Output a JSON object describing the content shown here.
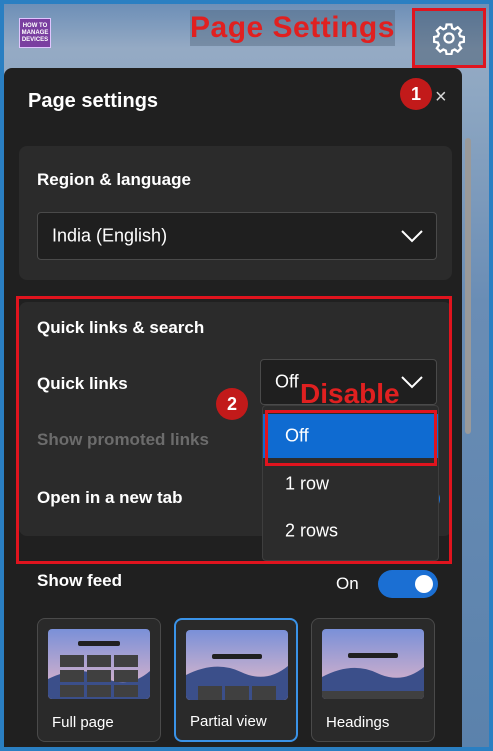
{
  "annotations": {
    "title": "Page Settings",
    "step1": "1",
    "step2": "2",
    "disable": "Disable"
  },
  "logo_text": "HOW TO MANAGE DEVICES",
  "panel": {
    "title": "Page settings",
    "close": "×"
  },
  "region": {
    "label": "Region & language",
    "value": "India (English)"
  },
  "quick": {
    "section_label": "Quick links & search",
    "quick_links_label": "Quick links",
    "quick_links_value": "Off",
    "show_promoted": "Show promoted links",
    "open_new_tab": "Open in a new tab",
    "options": [
      "Off",
      "1 row",
      "2 rows"
    ]
  },
  "feed": {
    "label": "Show feed",
    "state": "On",
    "layouts": [
      "Full page",
      "Partial view",
      "Headings"
    ],
    "selected": "Partial view"
  },
  "colors": {
    "accent": "#0f6bd1",
    "annotation": "#e0141e",
    "panel_bg": "#202020"
  }
}
